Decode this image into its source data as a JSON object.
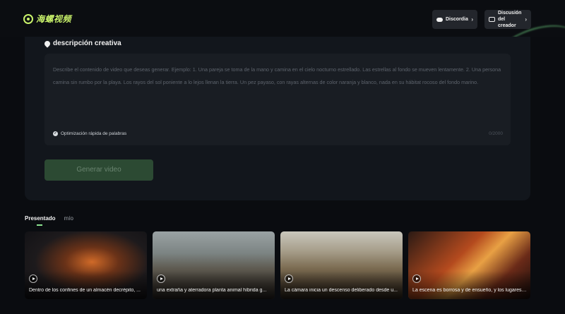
{
  "header": {
    "logo_text": "海螺视频",
    "discord_label": "Discordia",
    "creator_label": "Discusión del creador"
  },
  "prompt": {
    "title": "descripción creativa",
    "placeholder": "Describe el contenido de video que deseas generar. Ejemplo: 1. Una pareja se toma de la mano y camina en el cielo nocturno estrellado. Las estrellas al fondo se mueven lentamente. 2. Una persona camina sin rumbo por la playa. Los rayos del sol poniente a lo lejos llenan la tierra. Un pez payaso, con rayas alternas de color naranja y blanco, nada en su hábitat rocoso del fondo marino.",
    "optimization_label": "Optimización rápida de palabras",
    "counter": "0/2000",
    "generate_label": "Generar video"
  },
  "tabs": [
    {
      "label": "Presentado",
      "active": true
    },
    {
      "label": "mío",
      "active": false
    }
  ],
  "videos": [
    {
      "caption": "Dentro de los confines de un almacén decrépito, ..."
    },
    {
      "caption": "una extraña y aterradora planta animal híbrida g..."
    },
    {
      "caption": "La cámara inicia un descenso deliberado desde u..."
    },
    {
      "caption": "La escena es borrosa y de ensueño, y los lugares ..."
    }
  ]
}
